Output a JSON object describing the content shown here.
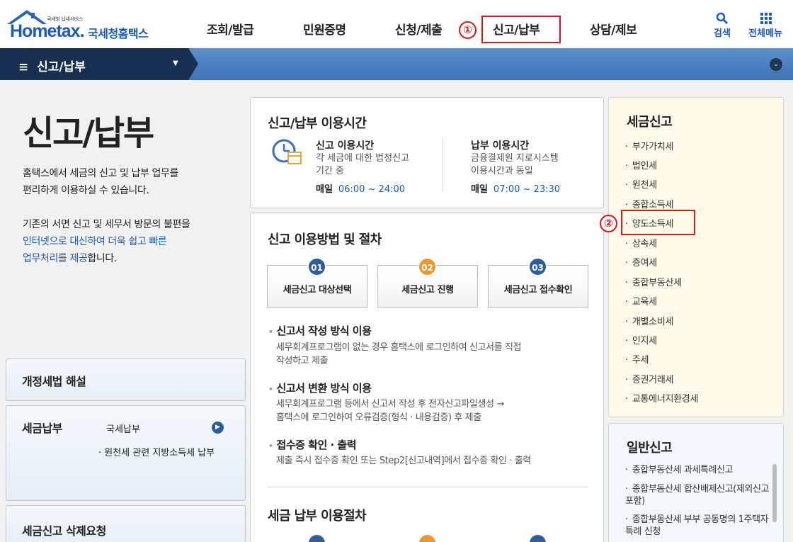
{
  "header": {
    "logo_sub": "국세청 납세서비스",
    "logo_en": "Hometax.",
    "logo_ko": "국세청홈택스",
    "nav": [
      "조회/발급",
      "민원증명",
      "신청/제출",
      "신고/납부",
      "상담/제보"
    ],
    "search_label": "검색",
    "menu_label": "전체메뉴"
  },
  "markers": {
    "one": "①",
    "two": "②"
  },
  "breadcrumb": {
    "label": "신고/납부"
  },
  "left": {
    "title": "신고/납부",
    "desc1_line1": "홈택스에서 세금의 신고 및 납부 업무를",
    "desc1_line2": "편리하게 이용하실 수 있습니다.",
    "desc2_line1": "기존의 서면 신고 및 세무서 방문의 불편을",
    "desc2_line2": "인터넷으로 대신하여 더욱 쉽고 빠른",
    "desc2_line3a": "업무처리를 제공",
    "desc2_line3b": "합니다.",
    "box1_title": "개정세법 해설",
    "box2_title": "세금납부",
    "box2_link1": "국세납부",
    "box2_link2": "· 원천세 관련 지방소득세 납부",
    "box3_title": "세금신고 삭제요청"
  },
  "hours": {
    "title": "신고/납부 이용시간",
    "report_h": "신고 이용시간",
    "report_d1": "각 세금에 대한 법정신고",
    "report_d2": "기간 중",
    "report_day": "매일",
    "report_time": "06:00 ~ 24:00",
    "pay_h": "납부 이용시간",
    "pay_d1": "금융결제원 지로시스템",
    "pay_d2": "이용시간과 동일",
    "pay_day": "매일",
    "pay_time": "07:00 ~ 23:30"
  },
  "procedure": {
    "title": "신고 이용방법 및 절차",
    "steps": [
      {
        "num": "01",
        "label": "세금신고 대상선택",
        "color": "#2f5d99"
      },
      {
        "num": "02",
        "label": "세금신고 진행",
        "color": "#f0962f"
      },
      {
        "num": "03",
        "label": "세금신고 접수확인",
        "color": "#2f5d99"
      }
    ],
    "m1_h": "신고서 작성 방식 이용",
    "m1_d1": "세무회계프로그램이 없는 경우 홈택스에 로그인하여 신고서를 직접",
    "m1_d2": "작성하고 제출",
    "m2_h": "신고서 변환 방식 이용",
    "m2_d1": "세무회계프로그램 등에서 신고서 작성 후 전자신고파일생성 →",
    "m2_d2": "홈택스에 로그인하여 오류검증(형식 · 내용검증) 후 제출",
    "m3_h": "접수증 확인 · 출력",
    "m3_d1": "제출 즉시 접수증 확인 또는 Step2[신고내역]에서 접수증 확인 · 출력",
    "pay_title": "세금 납부 이용절차"
  },
  "tax_report": {
    "title": "세금신고",
    "items": [
      "부가가치세",
      "법인세",
      "원천세",
      "종합소득세",
      "양도소득세",
      "상속세",
      "증여세",
      "종합부동산세",
      "교육세",
      "개별소비세",
      "인지세",
      "주세",
      "증권거래세",
      "교통에너지환경세"
    ]
  },
  "general_report": {
    "title": "일반신고",
    "item1": "종합부동산세 과세특례신고",
    "item2": "종합부동산세 합산배제신고(제외신고 포함)",
    "item3": "종합부동산세 부부 공동명의 1주택자 특례 신청"
  },
  "colors": {
    "brand": "#1d5bb4",
    "highlight": "#d41b1b",
    "bar": "#4a7fc1"
  }
}
